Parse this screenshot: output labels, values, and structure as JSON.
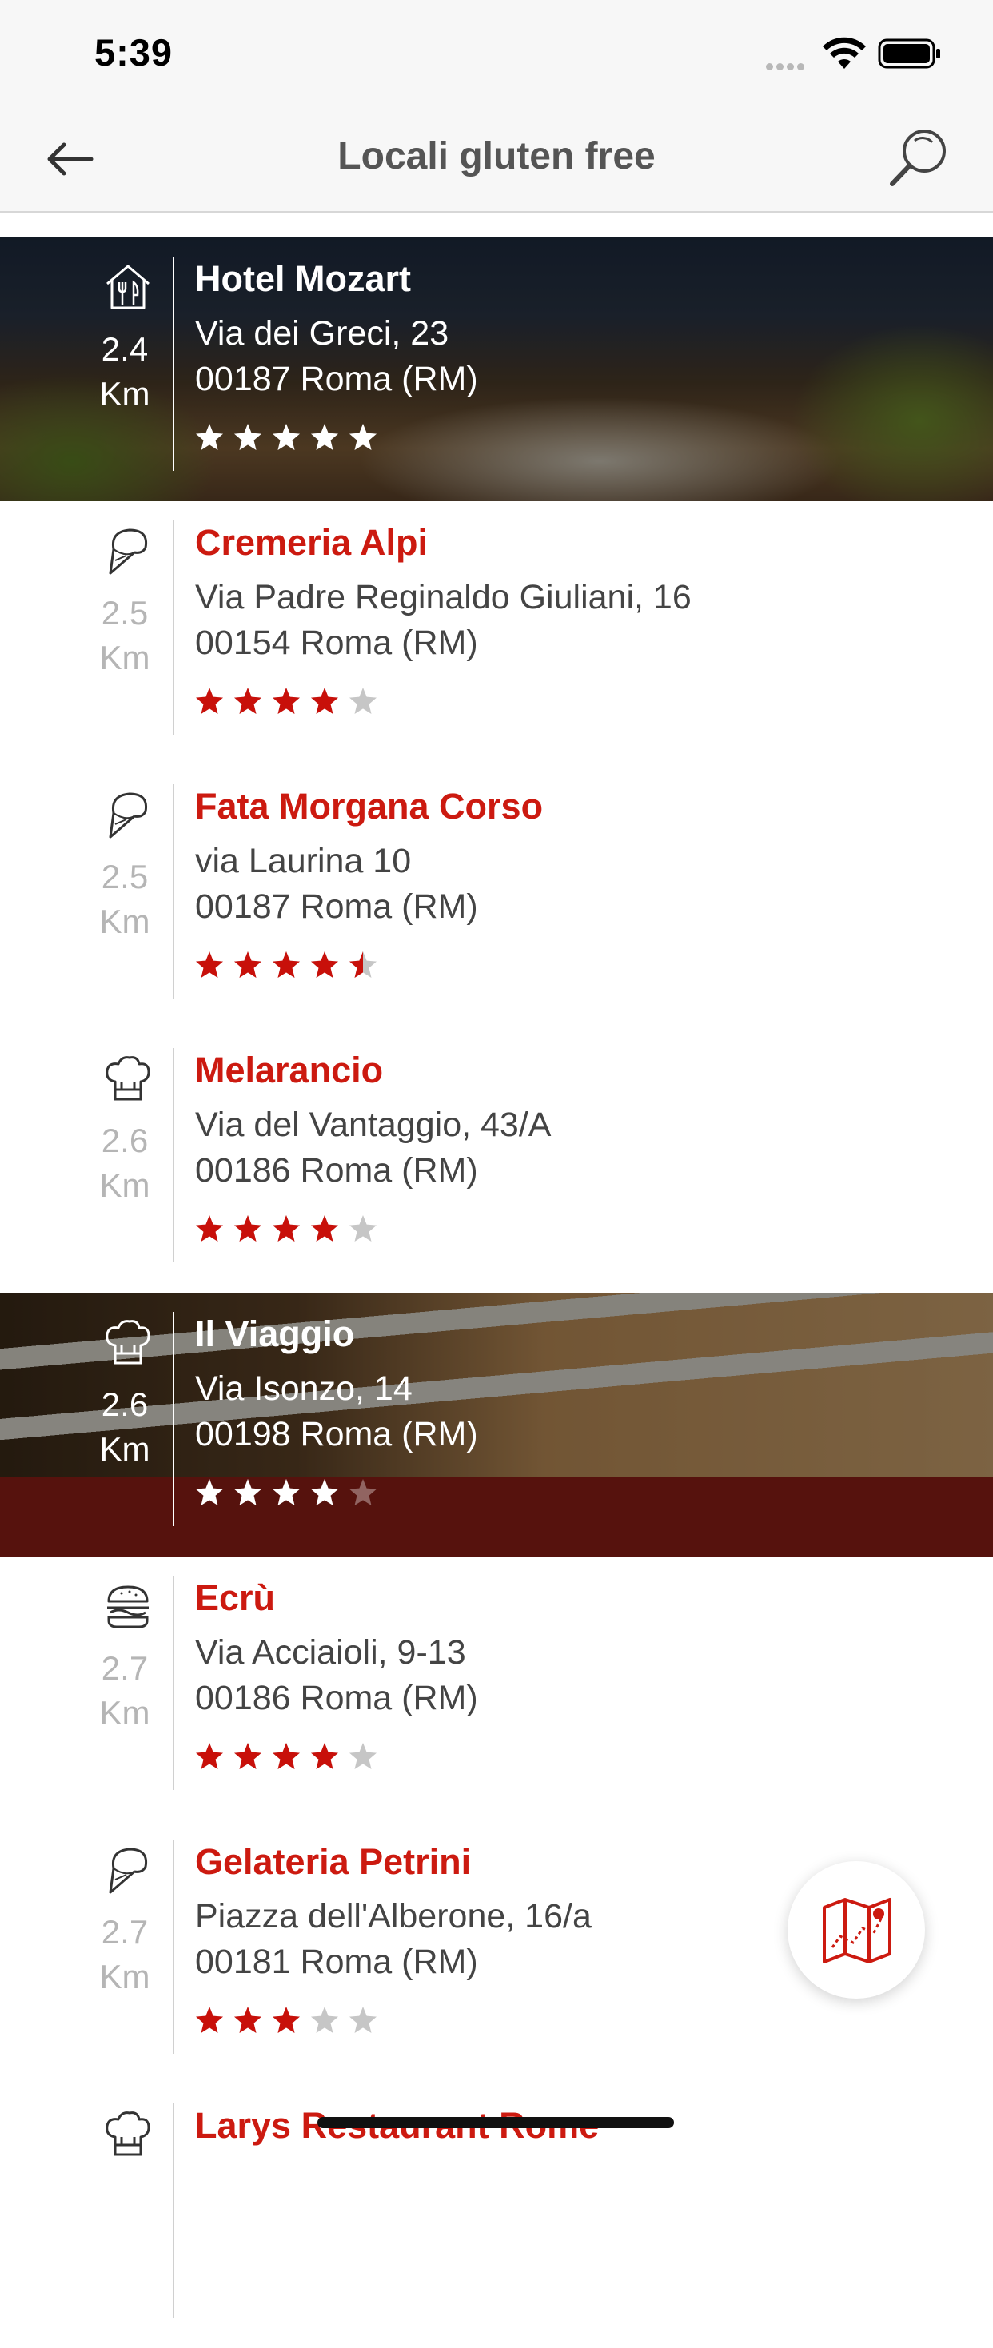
{
  "status_bar": {
    "time": "5:39"
  },
  "header": {
    "title": "Locali gluten free"
  },
  "places": [
    {
      "name": "Hotel Mozart",
      "address": "Via dei Greci, 23",
      "city": "00187 Roma (RM)",
      "distance": "2.4",
      "unit": "Km",
      "rating": 5,
      "icon": "restaurant-house-icon",
      "photo": "mozart"
    },
    {
      "name": "Cremeria Alpi",
      "address": "Via Padre Reginaldo Giuliani, 16",
      "city": "00154 Roma (RM)",
      "distance": "2.5",
      "unit": "Km",
      "rating": 4,
      "icon": "ice-cream-icon",
      "photo": ""
    },
    {
      "name": "Fata Morgana Corso",
      "address": "via Laurina 10",
      "city": "00187 Roma (RM)",
      "distance": "2.5",
      "unit": "Km",
      "rating": 4.5,
      "icon": "ice-cream-icon",
      "photo": ""
    },
    {
      "name": "Melarancio",
      "address": "Via del Vantaggio, 43/A",
      "city": "00186 Roma (RM)",
      "distance": "2.6",
      "unit": "Km",
      "rating": 4,
      "icon": "chef-hat-icon",
      "photo": ""
    },
    {
      "name": "Il Viaggio",
      "address": "Via Isonzo, 14",
      "city": "00198 Roma (RM)",
      "distance": "2.6",
      "unit": "Km",
      "rating": 4,
      "icon": "chef-hat-icon",
      "photo": "viaggio"
    },
    {
      "name": "Ecrù",
      "address": "Via Acciaioli, 9-13",
      "city": "00186 Roma (RM)",
      "distance": "2.7",
      "unit": "Km",
      "rating": 4,
      "icon": "burger-icon",
      "photo": ""
    },
    {
      "name": "Gelateria Petrini",
      "address": "Piazza dell'Alberone, 16/a",
      "city": "00181 Roma (RM)",
      "distance": "2.7",
      "unit": "Km",
      "rating": 3,
      "icon": "ice-cream-icon",
      "photo": ""
    },
    {
      "name": "Larys Restaurant Rome",
      "address": "",
      "city": "",
      "distance": "",
      "unit": "",
      "rating": 0,
      "icon": "chef-hat-icon",
      "photo": ""
    }
  ],
  "colors": {
    "accent": "#cc1a10",
    "star_empty": "#c6c6c6",
    "text": "#444444"
  },
  "fab": {
    "icon": "map-icon"
  }
}
